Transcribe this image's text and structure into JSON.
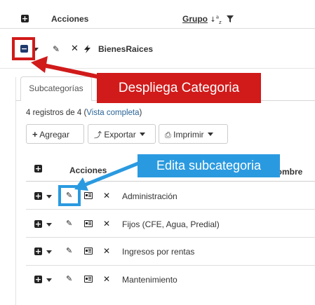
{
  "top_header": {
    "actions_label": "Acciones",
    "group_label": "Grupo",
    "sort_indicator": "↓a z",
    "icons": [
      "plus-square-icon",
      "filter-icon"
    ]
  },
  "group_row": {
    "name": "BienesRaices",
    "icons": [
      "minus-square-icon",
      "chevron-down-icon",
      "pencil-icon",
      "close-icon",
      "bolt-icon"
    ]
  },
  "tabs": [
    {
      "label": "Subcategorías",
      "active": true
    }
  ],
  "records": {
    "prefix": "4 registros de 4 (",
    "link": "Vista completa",
    "suffix": ")"
  },
  "toolbar": {
    "add_label": "Agregar",
    "export_label": "Exportar",
    "print_label": "Imprimir"
  },
  "sub_header": {
    "actions_label": "Acciones",
    "name_label": "Nombre"
  },
  "rows": [
    {
      "name": "Administración"
    },
    {
      "name": "Fijos (CFE, Agua, Predial)"
    },
    {
      "name": "Ingresos por rentas"
    },
    {
      "name": "Mantenimiento"
    }
  ],
  "callouts": {
    "red": "Despliega Categoria",
    "blue": "Edita subcategoria"
  },
  "colors": {
    "red": "#d11a1a",
    "blue": "#2a9ae0",
    "link": "#2a6496",
    "divider": "#dcdcdc"
  }
}
